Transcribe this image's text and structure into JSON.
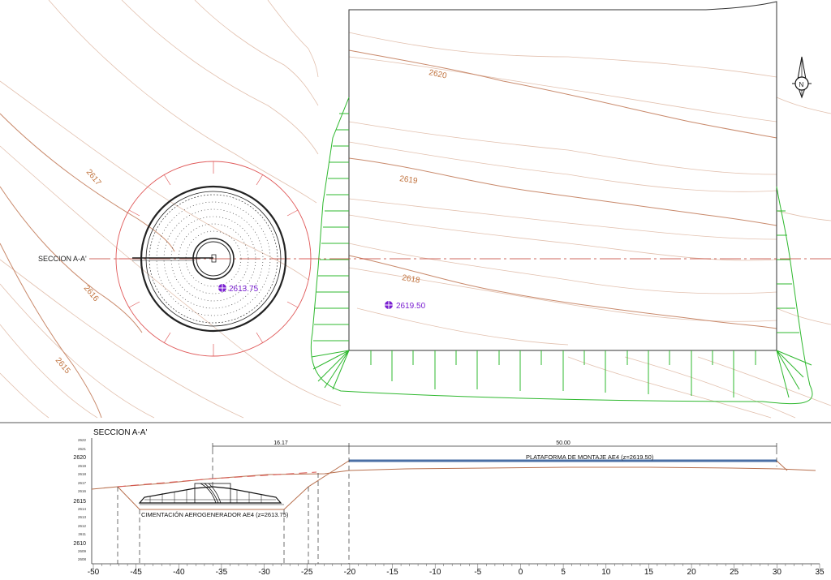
{
  "plan": {
    "contours": [
      "2620",
      "2619",
      "2618",
      "2617",
      "2616",
      "2615"
    ],
    "section_label": "SECCION A-A'",
    "elevation_marks": [
      "2613.75",
      "2619.50"
    ],
    "north_label": "N"
  },
  "section": {
    "title": "SECCION A-A'",
    "dimensions": [
      "16.17",
      "50.00"
    ],
    "platform_label": "PLATAFORMA DE MONTAJE AE4 (z=2619.50)",
    "foundation_label": "CIMENTACIÓN AEROGENERADOR AE4 (z=2613.75)",
    "elevation_ticks_major": [
      "2620",
      "2615",
      "2610"
    ],
    "elevation_ticks_minor": [
      "2622",
      "2621",
      "2619",
      "2618",
      "2617",
      "2616",
      "2614",
      "2613",
      "2612",
      "2611",
      "2609",
      "2608"
    ],
    "station_ticks": [
      "-50",
      "-45",
      "-40",
      "-35",
      "-30",
      "-25",
      "-20",
      "-15",
      "-10",
      "-5",
      "0",
      "5",
      "10",
      "15",
      "20",
      "25",
      "30",
      "35"
    ]
  },
  "colors": {
    "contour": "#c98a6c",
    "contour_major": "#b8704e",
    "foundation_ring": "#e05a5a",
    "slope": "#2fb82f",
    "line": "#222222",
    "mark": "#7a1fd1",
    "axis_red": "#c0392b",
    "platform_blue": "#4a6fa5"
  }
}
